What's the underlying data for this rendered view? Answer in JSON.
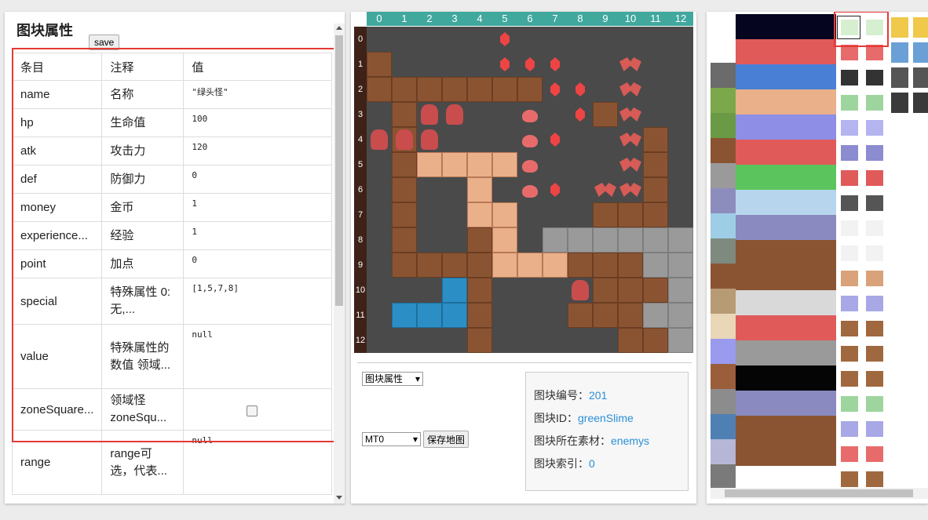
{
  "left_panel": {
    "title": "图块属性",
    "save_label": "save",
    "table": {
      "headers": [
        "条目",
        "注释",
        "值"
      ],
      "rows": [
        {
          "key": "name",
          "note": "名称",
          "value": "\"绿头怪\""
        },
        {
          "key": "hp",
          "note": "生命值",
          "value": "100"
        },
        {
          "key": "atk",
          "note": "攻击力",
          "value": "120"
        },
        {
          "key": "def",
          "note": "防御力",
          "value": "0"
        },
        {
          "key": "money",
          "note": "金币",
          "value": "1"
        },
        {
          "key": "experience...",
          "note": "经验",
          "value": "1"
        },
        {
          "key": "point",
          "note": "加点",
          "value": "0"
        },
        {
          "key": "special",
          "note": "特殊属性 0:无,...",
          "value": "[1,5,7,8]"
        },
        {
          "key": "value",
          "note": "特殊属性的数值 领域...",
          "value": "null"
        },
        {
          "key": "zoneSquare...",
          "note": "领域怪 zoneSqu...",
          "value": "",
          "checkbox": false
        },
        {
          "key": "range",
          "note": "range可选，代表...",
          "value": "null"
        }
      ]
    }
  },
  "map_panel": {
    "columns": [
      "0",
      "1",
      "2",
      "3",
      "4",
      "5",
      "6",
      "7",
      "8",
      "9",
      "10",
      "11",
      "12"
    ],
    "rows": [
      "0",
      "1",
      "2",
      "3",
      "4",
      "5",
      "6",
      "7",
      "8",
      "9",
      "10",
      "11",
      "12"
    ],
    "mode_select": "图块属性",
    "floor_select": "MT0",
    "save_map_label": "保存地图"
  },
  "tile_info": {
    "id_label": "图块编号：",
    "id_value": "201",
    "tid_label": "图块ID：",
    "tid_value": "greenSlime",
    "src_label": "图块所在素材：",
    "src_value": "enemys",
    "idx_label": "图块索引：",
    "idx_value": "0"
  },
  "colors": {
    "highlight": "#e53935",
    "header_teal": "#41a89e",
    "row_header": "#3e2218",
    "link": "#2a8fd6"
  }
}
